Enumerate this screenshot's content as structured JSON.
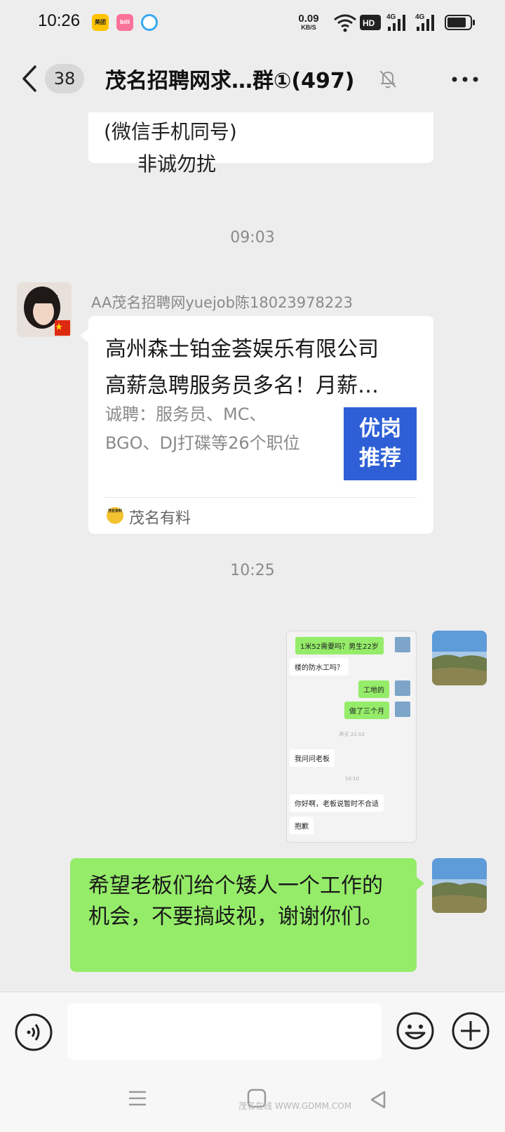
{
  "status_bar": {
    "time": "10:26",
    "apps": [
      "美团",
      "bili",
      "qq"
    ],
    "net_speed_value": "0.09",
    "net_speed_unit": "KB/S",
    "wifi_icon": "wifi-icon",
    "hd_icon": "hd2-icon",
    "signal_label": "4G",
    "battery_icon": "battery-icon"
  },
  "header": {
    "unread_count": "38",
    "title": "茂名招聘网求…群①(497)",
    "mute_icon": "mute-bell-icon",
    "more_icon": "more-dots-icon"
  },
  "messages": {
    "prev_text": {
      "line1": "(微信手机同号)",
      "line2": "非诚勿扰"
    },
    "time1": "09:03",
    "card_msg": {
      "sender": "AA茂名招聘网yuejob陈18023978223",
      "title1": "高州森士铂金荟娱乐有限公司",
      "title2": "高薪急聘服务员多名！月薪…",
      "desc": "诚聘：服务员、MC、BGO、DJ打碟等26个职位",
      "thumb_line1": "优岗",
      "thumb_line2": "推荐",
      "source_icon_text": "茂名有料",
      "source": "茂名有料"
    },
    "time2": "10:25",
    "screenshot_msg": {
      "rows": [
        {
          "side": "right",
          "text": "1米52需要吗？男生22岁"
        },
        {
          "side": "left",
          "text": "楼的防水工吗？"
        },
        {
          "side": "right",
          "text": "工地的"
        },
        {
          "side": "right",
          "text": "做了三个月"
        },
        {
          "side": "ts",
          "text": "昨天 21:02"
        },
        {
          "side": "left",
          "text": "我问问老板"
        },
        {
          "side": "ts",
          "text": "10:10"
        },
        {
          "side": "left",
          "text": "你好啊，老板说暂时不合适"
        },
        {
          "side": "left",
          "text": "抱歉"
        }
      ]
    },
    "text_msg": "希望老板们给个矮人一个工作的机会，不要搞歧视，谢谢你们。"
  },
  "input_bar": {
    "voice_icon": "voice-icon",
    "text_value": "",
    "emoji_icon": "emoji-icon",
    "plus_icon": "plus-icon"
  },
  "nav_bar": {
    "menu_icon": "menu-icon",
    "home_icon": "home-icon",
    "back_icon": "back-triangle-icon",
    "watermark": "茂名在线 WWW.GDMM.COM"
  },
  "colors": {
    "background": "#ededed",
    "green_bubble": "#95ec69",
    "white_bubble": "#ffffff",
    "thumb_blue": "#2e5fd6"
  }
}
